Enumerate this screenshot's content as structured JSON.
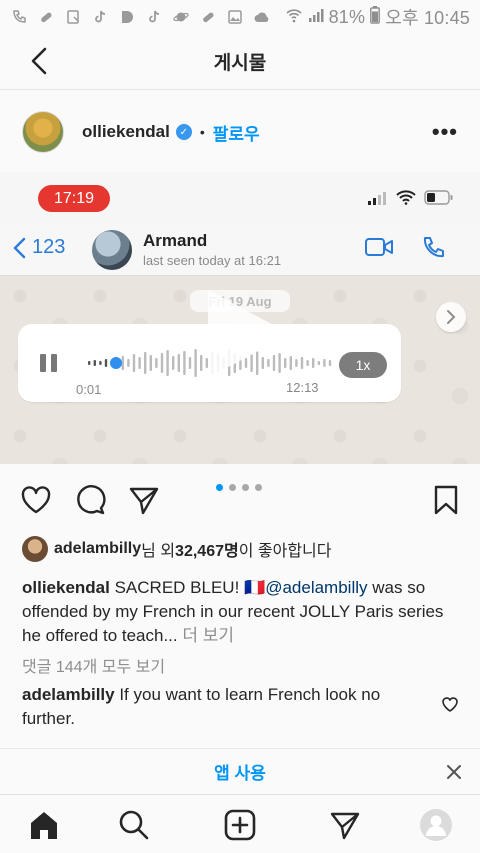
{
  "status_bar": {
    "battery": "81%",
    "time": "오후 10:45"
  },
  "header": {
    "title": "게시물"
  },
  "post": {
    "author": "olliekendal",
    "follow_label": "팔로우",
    "separator": "•"
  },
  "media": {
    "phone_time": "17:19",
    "back_count": "123",
    "contact_name": "Armand",
    "last_seen": "last seen today at 16:21",
    "date_label": "Fri 19 Aug",
    "voice_elapsed": "0:01",
    "voice_duration": "12:13",
    "speed_label": "1x",
    "carousel_total": 4,
    "carousel_active": 1
  },
  "likes": {
    "user": "adelambilly",
    "suffix_1": "님 외 ",
    "count": "32,467명",
    "suffix_2": "이 좋아합니다"
  },
  "caption": {
    "author": "olliekendal",
    "text_1": " SACRED BLEU! 🇫🇷",
    "mention": "@adelambilly",
    "text_2": " was so offended by my French in our recent JOLLY Paris series he offered to teach...",
    "more": " 더 보기"
  },
  "comments": {
    "view_all": "댓글 144개 모두 보기",
    "items": [
      {
        "user": "adelambilly",
        "text": " If you want to learn French look no further."
      }
    ]
  },
  "app_banner": {
    "label": "앱 사용"
  },
  "colors": {
    "accent": "#0095f6",
    "mention": "#00376b",
    "muted": "#8e8e8e",
    "time_pill": "#e5372f",
    "whatsapp_blue": "#2a7bd7"
  }
}
